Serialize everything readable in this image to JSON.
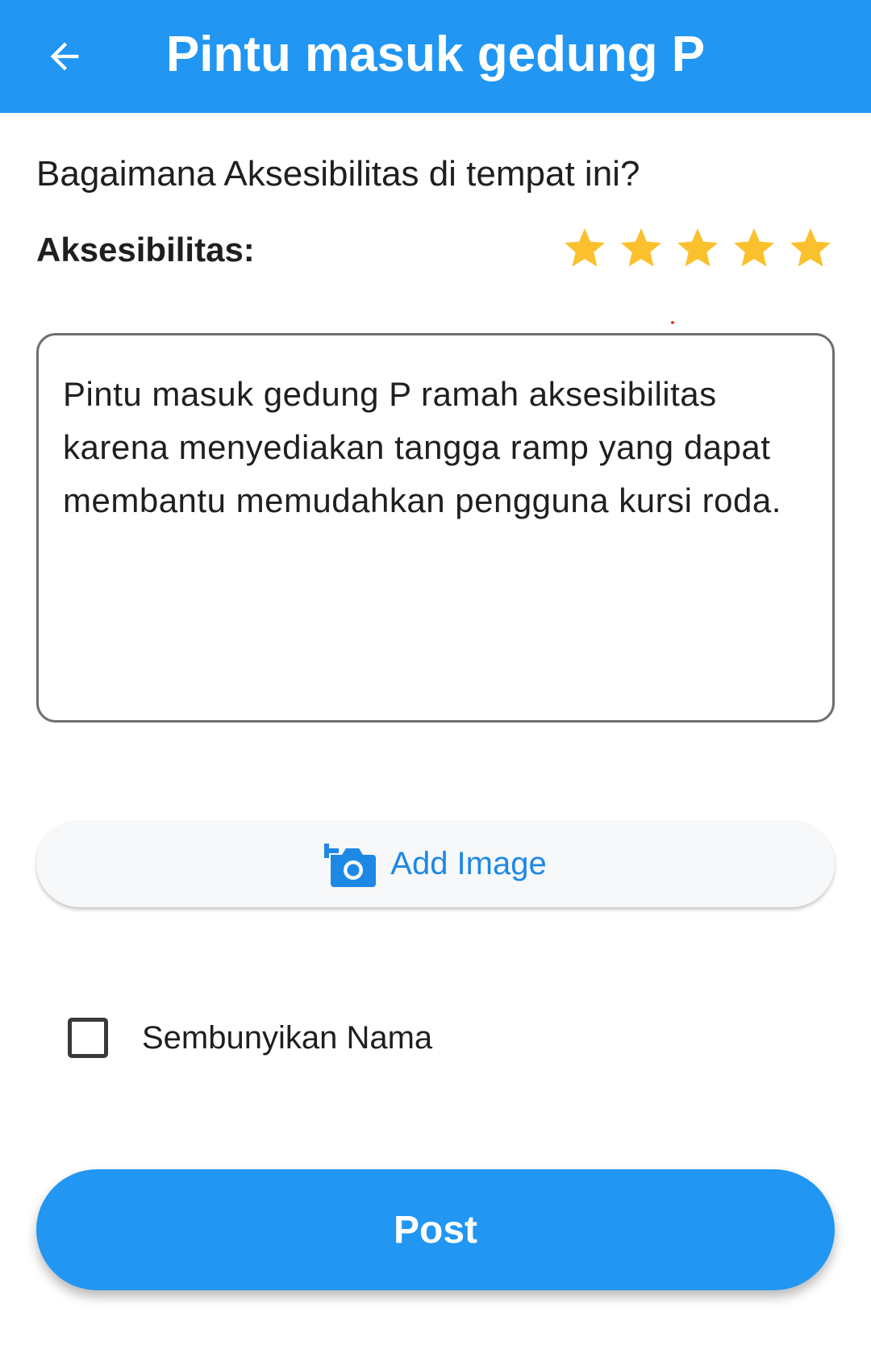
{
  "app_bar": {
    "title": "Pintu masuk gedung P",
    "back_icon": "arrow-left-icon",
    "background": "#2196F3"
  },
  "form": {
    "question": "Bagaimana Aksesibilitas di tempat ini?",
    "rating_label": "Aksesibilitas:",
    "rating": {
      "value": 5,
      "max": 5,
      "star_color": "#FBC02D"
    },
    "review_text": "Pintu masuk gedung P ramah aksesibilitas karena menyediakan tangga ramp yang dapat membantu memudahkan pengguna kursi roda.",
    "add_image": {
      "label": "Add Image",
      "icon": "add-photo-icon",
      "color": "#1E88E5"
    },
    "hide_name": {
      "label": "Sembunyikan Nama",
      "checked": false
    },
    "post_label": "Post"
  }
}
